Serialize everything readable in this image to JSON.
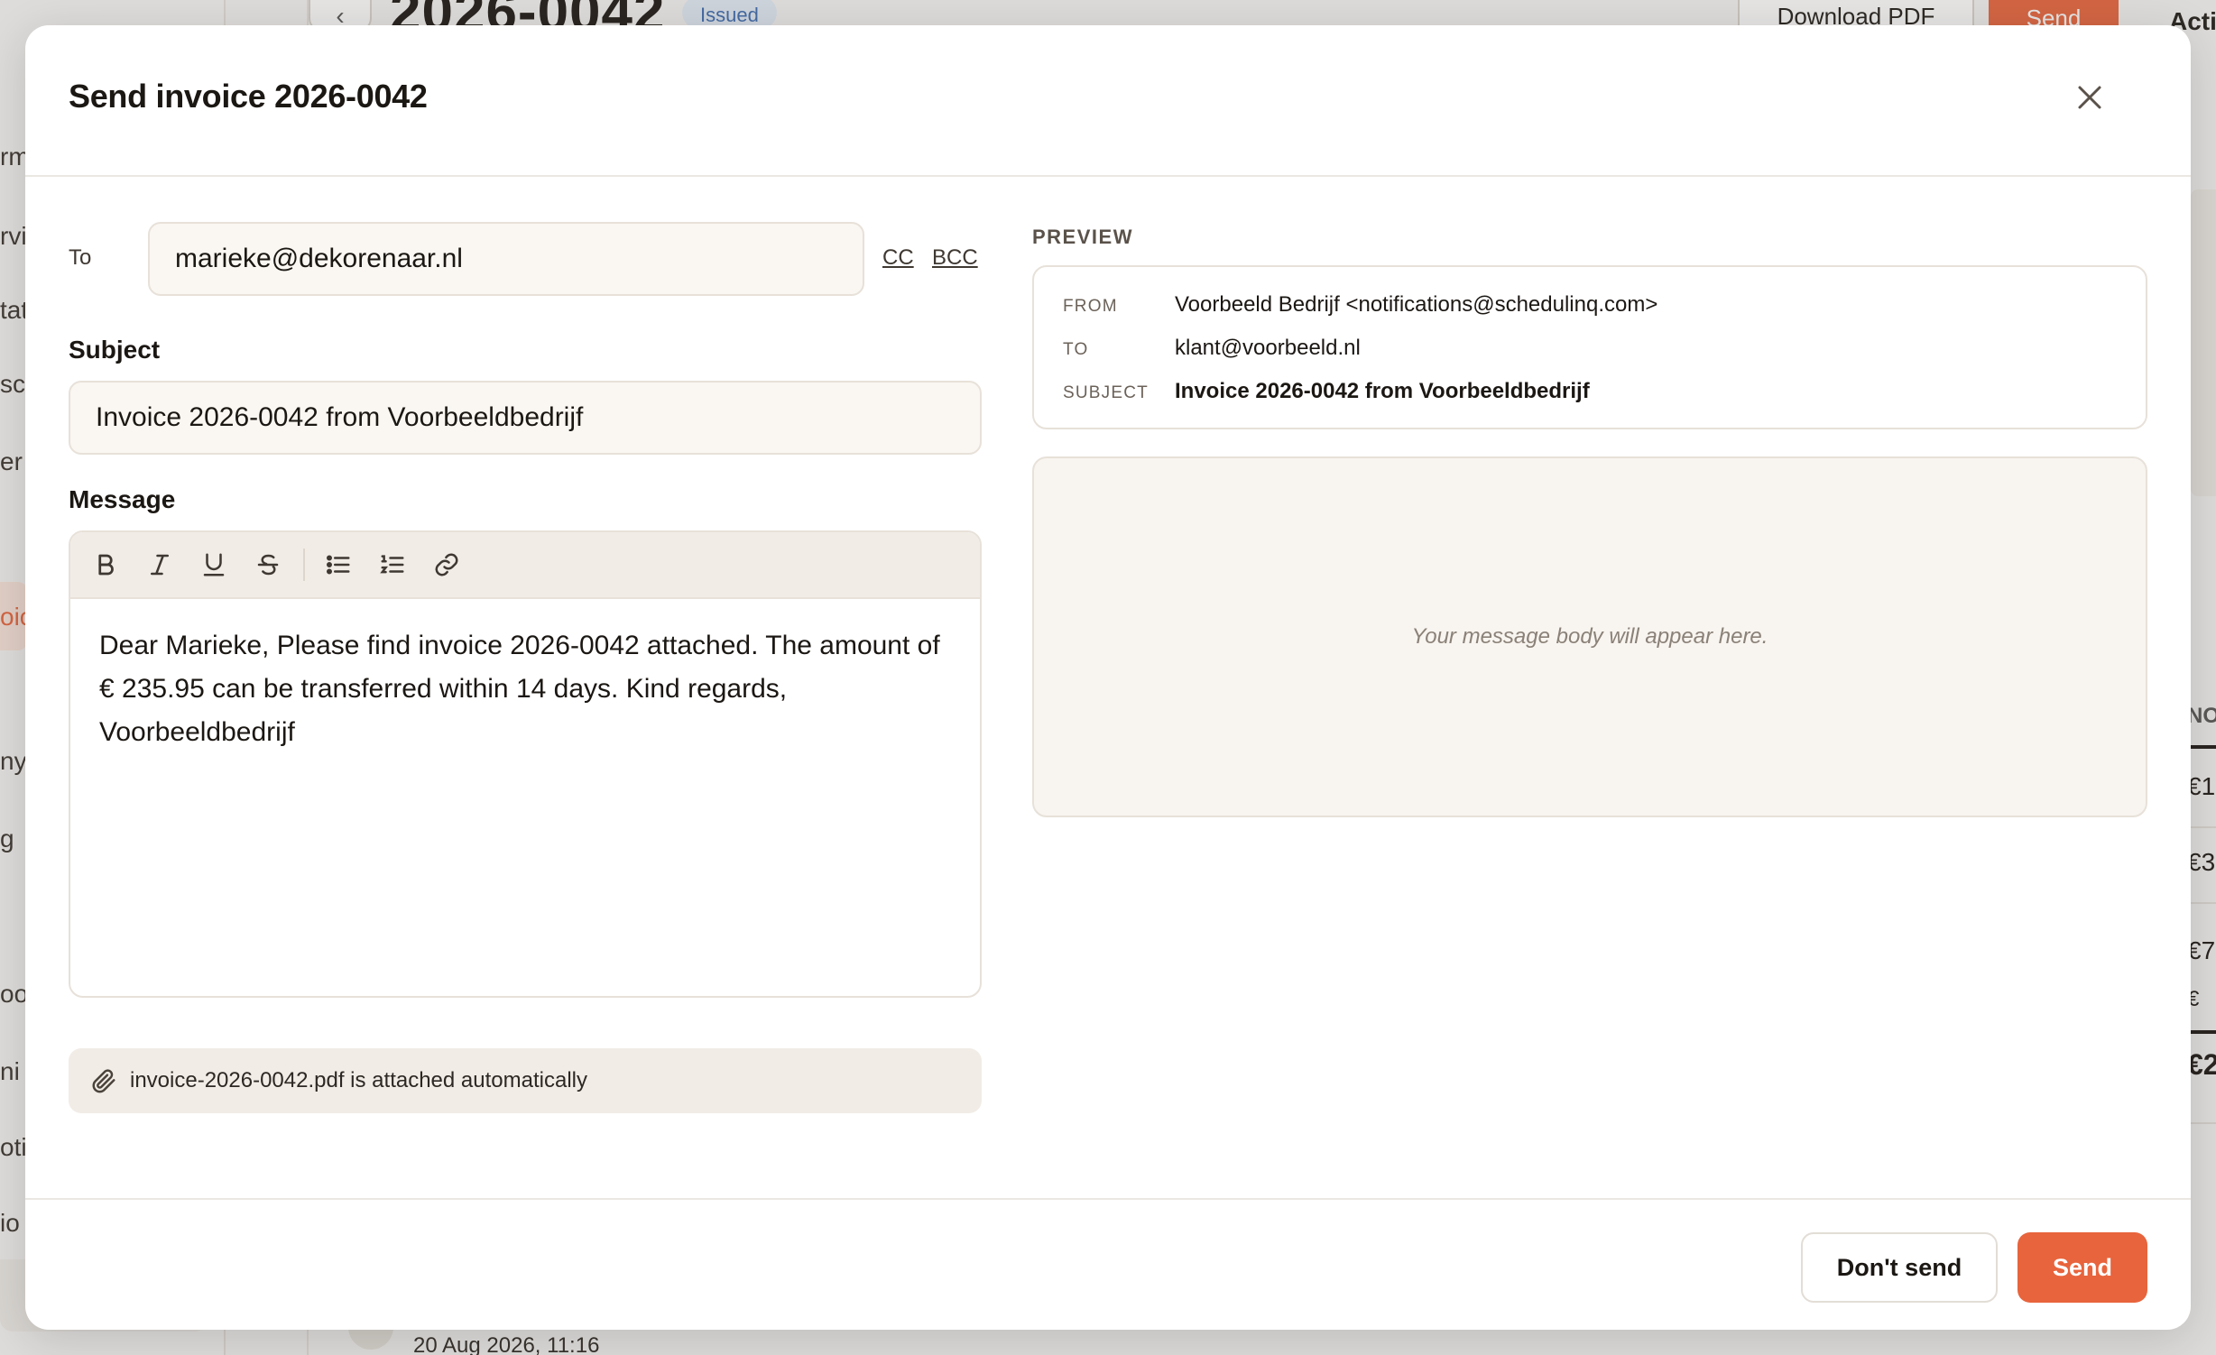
{
  "background": {
    "title": "2026-0042",
    "status_badge": "Issued",
    "download_pdf_label": "Download PDF",
    "send_label": "Send",
    "actions_label": "Acti",
    "table_head": "NO",
    "amounts": [
      "€1",
      "€3",
      "€7",
      "€",
      "€2"
    ],
    "timestamp": "20 Aug 2026, 11:16",
    "sidebar_fragments": [
      "rm",
      "rvi",
      "tat",
      "sc",
      "er",
      "oic",
      "ny",
      "g",
      "oo",
      "ni",
      "oti",
      "io"
    ],
    "back_icon": "chevron-left-icon"
  },
  "modal": {
    "title": "Send invoice 2026-0042",
    "close_icon": "close-icon",
    "to_label": "To",
    "to_value": "marieke@dekorenaar.nl",
    "cc_label": "CC",
    "bcc_label": "BCC",
    "subject_label": "Subject",
    "subject_value": "Invoice 2026-0042 from Voorbeeldbedrijf",
    "message_label": "Message",
    "toolbar_icons": [
      "bold-icon",
      "italic-icon",
      "underline-icon",
      "strikethrough-icon",
      "bullet-list-icon",
      "numbered-list-icon",
      "link-icon"
    ],
    "message_body": "Dear Marieke, Please find invoice 2026-0042 attached. The amount of € 235.95 can be transferred within 14 days. Kind regards, Voorbeeldbedrijf",
    "attachment_icon": "paperclip-icon",
    "attachment_text": "invoice-2026-0042.pdf is attached automatically",
    "preview": {
      "label": "PREVIEW",
      "from_key": "FROM",
      "from_value": "Voorbeeld Bedrijf <notifications@schedulinq.com>",
      "to_key": "TO",
      "to_value": "klant@voorbeeld.nl",
      "subject_key": "SUBJECT",
      "subject_value": "Invoice 2026-0042 from Voorbeeldbedrijf",
      "body_placeholder": "Your message body will appear here."
    },
    "footer": {
      "dont_send_label": "Don't send",
      "send_label": "Send"
    }
  },
  "colors": {
    "accent": "#e8643c",
    "input_bg": "#faf6f1",
    "toolbar_bg": "#f1ece6",
    "badge_bg": "#e3ecf7"
  }
}
